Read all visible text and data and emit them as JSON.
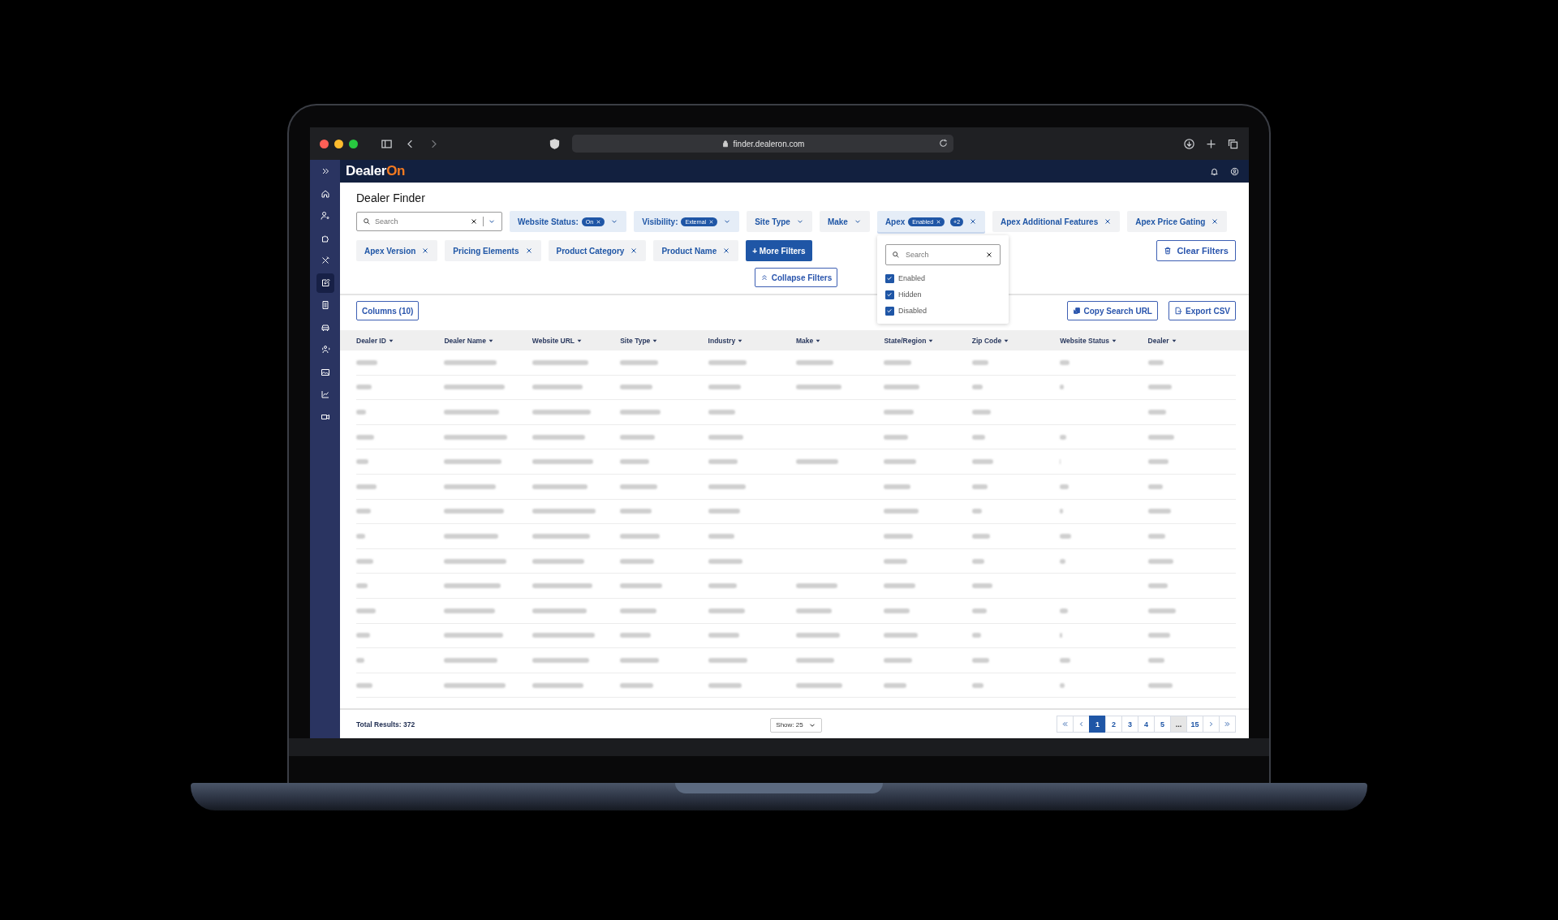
{
  "browser": {
    "url": "finder.dealeron.com"
  },
  "app": {
    "logo": "Dealer",
    "logo_accent": "On"
  },
  "sidebar": {
    "items": [
      {
        "kind": "expand",
        "selected": false
      },
      {
        "kind": "home",
        "selected": false
      },
      {
        "kind": "user-gear",
        "selected": false
      },
      {
        "kind": "puzzle",
        "selected": false
      },
      {
        "kind": "tools",
        "selected": false
      },
      {
        "kind": "edit",
        "selected": true
      },
      {
        "kind": "document",
        "selected": false
      },
      {
        "kind": "car",
        "selected": false
      },
      {
        "kind": "people",
        "selected": false
      },
      {
        "kind": "image",
        "selected": false
      },
      {
        "kind": "chart",
        "selected": false
      },
      {
        "kind": "video",
        "selected": false
      }
    ]
  },
  "page_title": "Dealer Finder",
  "search": {
    "placeholder": "Search"
  },
  "filter_rows": [
    [
      {
        "label": "Website Status:",
        "kind": "dropdown",
        "active": true,
        "value": "On"
      },
      {
        "label": "Visibility:",
        "kind": "dropdown",
        "active": true,
        "value": "External"
      },
      {
        "label": "Site Type",
        "kind": "dropdown",
        "active": false
      },
      {
        "label": "Make",
        "kind": "dropdown",
        "active": false
      },
      {
        "label": "Apex",
        "kind": "removable",
        "active": true,
        "value": "Enabled",
        "extra": "+2",
        "expanded": true,
        "menu": {
          "placeholder": "Search",
          "options": [
            {
              "label": "Enabled",
              "checked": true
            },
            {
              "label": "Hidden",
              "checked": true
            },
            {
              "label": "Disabled",
              "checked": true
            }
          ]
        }
      },
      {
        "label": "Apex Additional Features",
        "kind": "removable",
        "active": false
      },
      {
        "label": "Apex Price Gating",
        "kind": "removable",
        "active": false
      }
    ],
    [
      {
        "label": "Apex Version",
        "kind": "removable",
        "active": false
      },
      {
        "label": "Pricing Elements",
        "kind": "removable",
        "active": false
      },
      {
        "label": "Product Category",
        "kind": "removable",
        "active": false
      },
      {
        "label": "Product Name",
        "kind": "removable",
        "active": false
      }
    ]
  ],
  "buttons": {
    "more_filters": "+ More Filters",
    "clear_filters": "Clear Filters",
    "collapse_filters": "Collapse Filters",
    "columns": "Columns (10)",
    "copy_url": "Copy Search URL",
    "export_csv": "Export CSV"
  },
  "table": {
    "columns": [
      "Dealer ID",
      "Dealer Name",
      "Website URL",
      "Site Type",
      "Industry",
      "Make",
      "State/Region",
      "Zip Code",
      "Website Status",
      "Dealer"
    ]
  },
  "footer": {
    "total": "Total Results: 372",
    "page_size": "Show: 25",
    "pages": [
      {
        "label": "1",
        "kind": "page",
        "selected": true
      },
      {
        "label": "2",
        "kind": "page",
        "selected": false
      },
      {
        "label": "3",
        "kind": "page",
        "selected": false
      },
      {
        "label": "4",
        "kind": "page",
        "selected": false
      },
      {
        "label": "5",
        "kind": "page",
        "selected": false
      },
      {
        "label": "...",
        "kind": "ellipsis",
        "selected": false
      },
      {
        "label": "15",
        "kind": "page",
        "selected": false
      }
    ]
  }
}
